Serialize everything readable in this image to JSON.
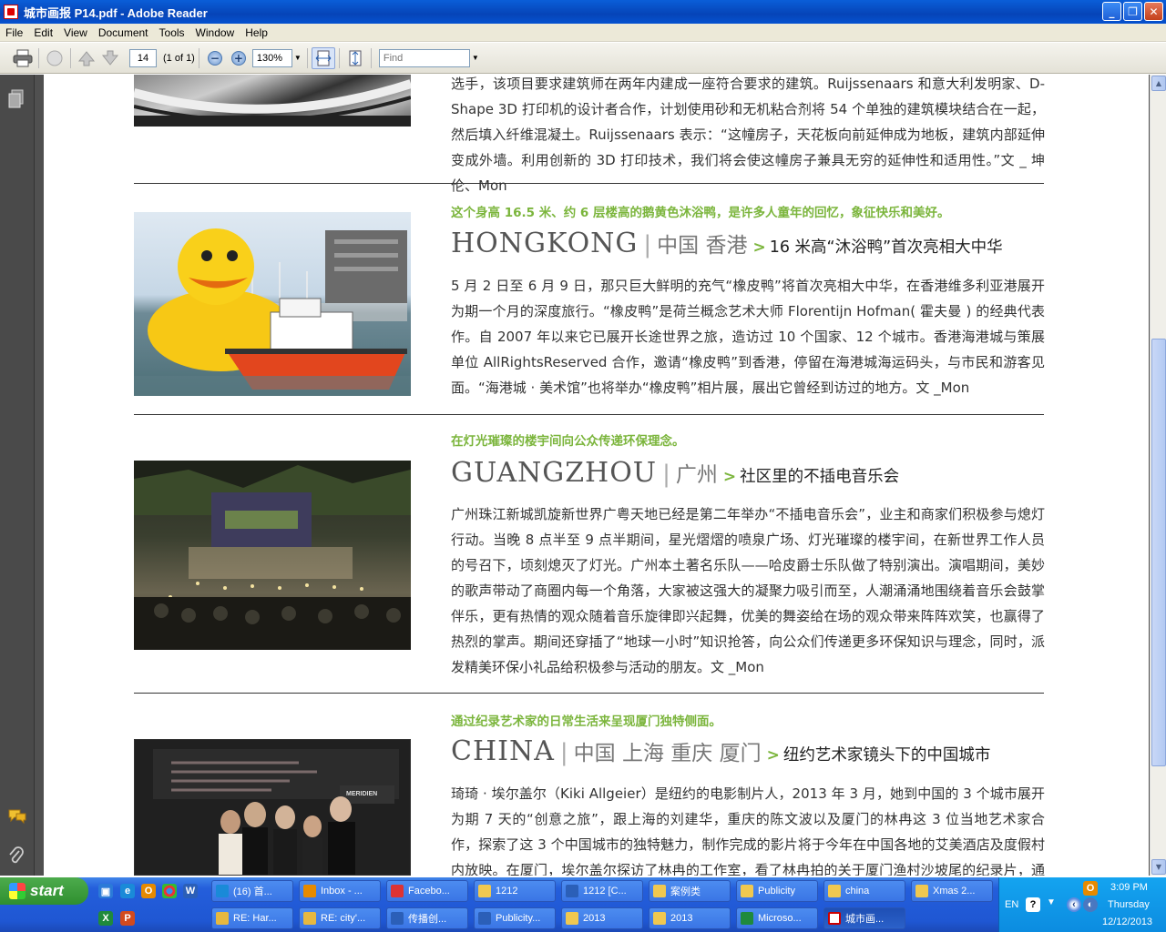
{
  "window": {
    "title": "城市画报 P14.pdf - Adobe Reader",
    "minimize": "_",
    "restore": "❐",
    "close": "✕"
  },
  "menu": [
    "File",
    "Edit",
    "View",
    "Document",
    "Tools",
    "Window",
    "Help"
  ],
  "toolbar": {
    "page_number": "14",
    "page_count": "(1 of 1)",
    "zoom": "130%",
    "find_placeholder": "Find"
  },
  "article": {
    "top_body": "选手，该项目要求建筑师在两年内建成一座符合要求的建筑。Ruijssenaars 和意大利发明家、D-Shape 3D 打印机的设计者合作，计划使用砂和无机粘合剂将 54 个单独的建筑模块结合在一起，然后填入纤维混凝土。Ruijssenaars 表示：“这幢房子，天花板向前延伸成为地板，建筑内部延伸变成外墙。利用创新的 3D 打印技术，我们将会使这幢房子兼具无穷的延伸性和适用性。”文 _ 坤伦、Mon",
    "sections": [
      {
        "tagline": "这个身高 16.5 米、约 6 层楼高的鹅黄色沐浴鸭，是许多人童年的回忆，象征快乐和美好。",
        "city_en": "HONGKONG",
        "city_cn": "中国 香港",
        "subhead": "16 米高“沐浴鸭”首次亮相大中华",
        "body": "5 月 2 日至 6 月 9 日，那只巨大鲜明的充气“橡皮鸭”将首次亮相大中华，在香港维多利亚港展开为期一个月的深度旅行。“橡皮鸭”是荷兰概念艺术大师 Florentijn Hofman( 霍夫曼 ) 的经典代表作。自 2007 年以来它已展开长途世界之旅，造访过 10 个国家、12 个城市。香港海港城与策展单位 AllRightsReserved 合作，邀请“橡皮鸭”到香港，停留在海港城海运码头，与市民和游客见面。“海港城 · 美术馆”也将举办“橡皮鸭”相片展，展出它曾经到访过的地方。文 _Mon"
      },
      {
        "tagline": "在灯光璀璨的楼宇间向公众传递环保理念。",
        "city_en": "GUANGZHOU",
        "city_cn": "广州",
        "subhead": "社区里的不插电音乐会",
        "body": "广州珠江新城凯旋新世界广粤天地已经是第二年举办“不插电音乐会”，业主和商家们积极参与熄灯行动。当晚 8 点半至 9 点半期间，星光熠熠的喷泉广场、灯光璀璨的楼宇间，在新世界工作人员的号召下，顷刻熄灭了灯光。广州本土著名乐队——哈皮爵士乐队做了特别演出。演唱期间，美妙的歌声带动了商圈内每一个角落，大家被这强大的凝聚力吸引而至，人潮涌涌地围绕着音乐会鼓掌伴乐，更有热情的观众随着音乐旋律即兴起舞，优美的舞姿给在场的观众带来阵阵欢笑，也赢得了热烈的掌声。期间还穿插了“地球一小时”知识抢答，向公众们传递更多环保知识与理念，同时，派发精美环保小礼品给积极参与活动的朋友。文 _Mon"
      },
      {
        "tagline": "通过纪录艺术家的日常生活来呈现厦门独特侧面。",
        "city_en": "CHINA",
        "city_cn": "中国 上海 重庆 厦门",
        "subhead": "纽约艺术家镜头下的中国城市",
        "body": "琦琦 · 埃尔盖尔（Kiki Allgeier）是纽约的电影制片人，2013 年 3 月，她到中国的 3 个城市展开为期 7 天的“创意之旅”，跟上海的刘建华，重庆的陈文波以及厦门的林冉这 3 位当地艺术家合作，探索了这 3 个中国城市的独特魅力，制作完成的影片将于今年在中国各地的艾美酒店及度假村内放映。在厦门，埃尔盖尔探访了林冉的工作室，看了林冉拍的关于厦门渔村沙坡尾的纪录片，通过纪录林冉的"
      }
    ],
    "photo3_sign": "MERIDIEN"
  },
  "taskbar": {
    "start": "start",
    "row1": [
      "(16) 首...",
      "Inbox - ...",
      "Facebo...",
      "1212",
      "1212 [C...",
      "案例类",
      "Publicity",
      "china",
      "Xmas 2..."
    ],
    "row2": [
      "RE: Har...",
      "RE: city'...",
      "传播创...",
      "Publicity...",
      "2013",
      "2013",
      "Microso...",
      "城市画..."
    ],
    "lang": "EN",
    "time": "3:09 PM",
    "day": "Thursday",
    "date": "12/12/2013"
  },
  "colors": {
    "accent_green": "#7bb53c",
    "xp_blue": "#245edb",
    "start_green": "#3a9a3a"
  }
}
